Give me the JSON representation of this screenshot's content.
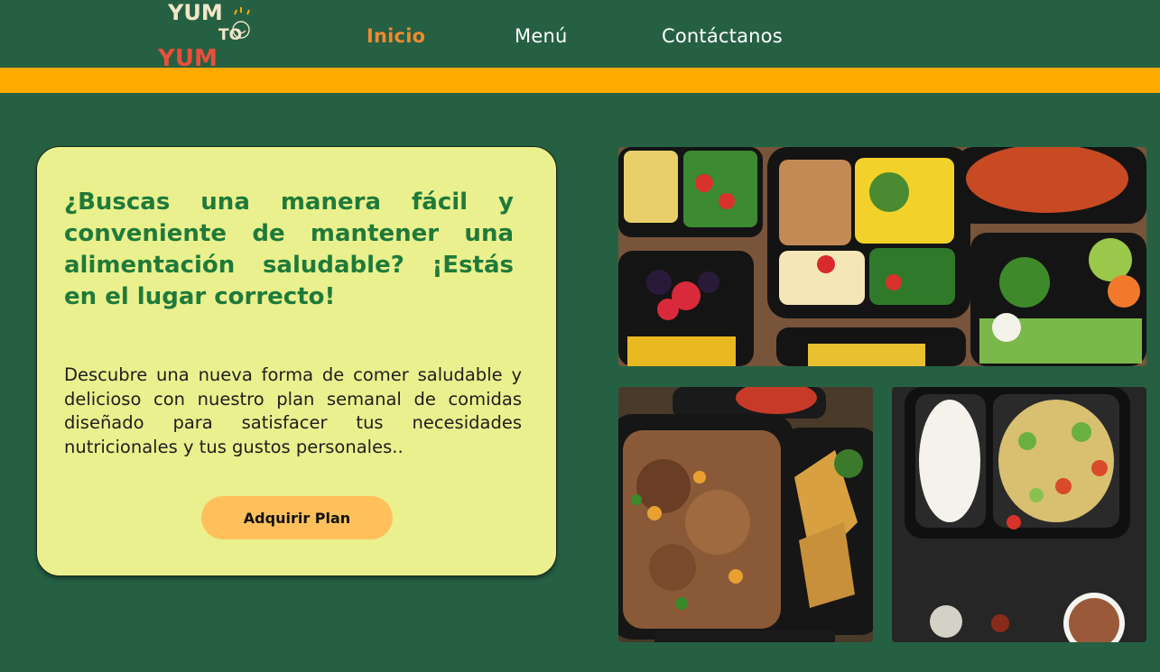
{
  "brand": {
    "logo_line1": "YUM",
    "logo_mid": "TO",
    "logo_line2": "YUM"
  },
  "nav": {
    "items": [
      {
        "label": "Inicio",
        "active": true
      },
      {
        "label": "Menú",
        "active": false
      },
      {
        "label": "Contáctanos",
        "active": false
      }
    ]
  },
  "hero": {
    "headline": "¿Buscas una manera fácil y conveniente de mantener una alimentación saludable? ¡Estás en el lugar correcto!",
    "description": "Descubre una nueva forma de comer saludable y delicioso con nuestro plan semanal de comidas diseñado para satisfacer tus necesidades nutricionales y tus gustos personales..",
    "cta_label": "Adquirir Plan"
  },
  "gallery": {
    "images": [
      {
        "icon": "meal-prep-containers-photo"
      },
      {
        "icon": "pulled-meat-and-nachos-photo"
      },
      {
        "icon": "rice-and-salad-container-photo"
      }
    ]
  },
  "colors": {
    "background": "#266043",
    "stripe": "#ffaa00",
    "card": "#eaf08e",
    "headline": "#1f7a3a",
    "nav_active": "#f08a2e",
    "cta": "#ffc05c"
  }
}
